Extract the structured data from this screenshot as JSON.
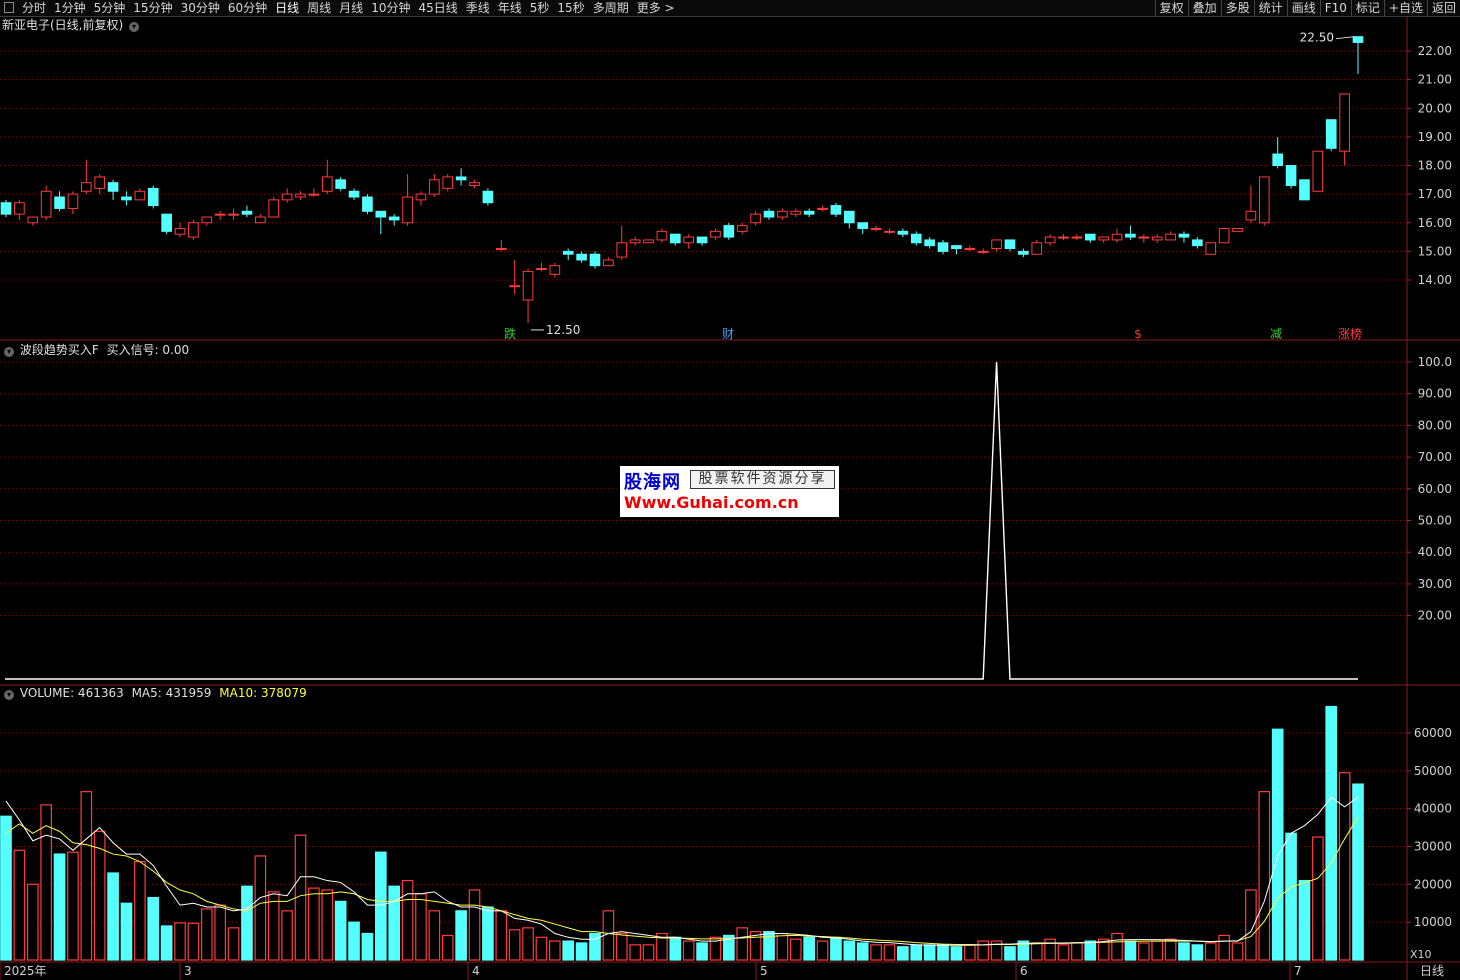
{
  "toolbar": {
    "periods": [
      "分时",
      "1分钟",
      "5分钟",
      "15分钟",
      "30分钟",
      "60分钟",
      "日线",
      "周线",
      "月线",
      "10分钟",
      "45日线",
      "季线",
      "年线",
      "5秒",
      "15秒",
      "多周期",
      "更多 >"
    ],
    "active_period": "日线",
    "right_buttons": [
      "复权",
      "叠加",
      "多股",
      "统计",
      "画线",
      "F10",
      "标记",
      "+自选",
      "返回"
    ]
  },
  "price_panel": {
    "title": "新亚电子(日线,前复权)",
    "axis_ticks": [
      "22.00",
      "21.00",
      "20.00",
      "19.00",
      "18.00",
      "17.00",
      "16.00",
      "15.00",
      "14.00"
    ],
    "high_label": "22.50",
    "low_label": "12.50",
    "markers": [
      {
        "text": "跌",
        "color": "#30d030"
      },
      {
        "text": "财",
        "color": "#40a0ff"
      },
      {
        "text": "$",
        "color": "#ff3030"
      },
      {
        "text": "减",
        "color": "#30d030"
      },
      {
        "text": "涨榜",
        "color": "#ff4040"
      }
    ]
  },
  "indicator_panel": {
    "title": "波段趋势买入F",
    "signal_label": "买入信号: 0.00",
    "axis_ticks": [
      "100.0",
      "90.00",
      "80.00",
      "70.00",
      "60.00",
      "50.00",
      "40.00",
      "30.00",
      "20.00"
    ]
  },
  "volume_panel": {
    "volume_label": "VOLUME: 461363",
    "ma5_label": "MA5: 431959",
    "ma10_label": "MA10: 378079",
    "axis_ticks": [
      "60000",
      "50000",
      "40000",
      "30000",
      "20000",
      "10000"
    ],
    "unit_label": "X10"
  },
  "x_axis": {
    "labels": [
      "2025年",
      "3",
      "4",
      "5",
      "6",
      "7"
    ],
    "period_label": "日线"
  },
  "watermark": {
    "brand": "股海网",
    "slogan": "股票软件资源分享",
    "url": "Www.Guhai.com.cn"
  },
  "colors": {
    "up": "#ff3b3b",
    "down": "#54ffff",
    "ma5": "#ffffff",
    "ma10": "#ffff40",
    "grid": "#8b0000"
  },
  "chart_data": {
    "type": "candlestick",
    "candles": [
      [
        16.7,
        16.3,
        16.8,
        16.2
      ],
      [
        16.3,
        16.7,
        16.8,
        16.1
      ],
      [
        16.0,
        16.2,
        16.2,
        15.9
      ],
      [
        16.2,
        17.1,
        17.3,
        16.1
      ],
      [
        16.9,
        16.5,
        17.1,
        16.4
      ],
      [
        16.5,
        17.0,
        17.1,
        16.3
      ],
      [
        17.1,
        17.4,
        18.2,
        17.0
      ],
      [
        17.2,
        17.6,
        17.7,
        17.0
      ],
      [
        17.4,
        17.1,
        17.5,
        16.8
      ],
      [
        16.9,
        16.8,
        17.1,
        16.6
      ],
      [
        16.8,
        17.1,
        17.2,
        16.8
      ],
      [
        17.2,
        16.6,
        17.3,
        16.5
      ],
      [
        16.3,
        15.7,
        16.3,
        15.6
      ],
      [
        15.6,
        15.8,
        16.0,
        15.5
      ],
      [
        15.5,
        16.0,
        16.1,
        15.4
      ],
      [
        16.0,
        16.2,
        16.2,
        15.9
      ],
      [
        16.3,
        16.3,
        16.4,
        16.1
      ],
      [
        16.3,
        16.3,
        16.5,
        16.1
      ],
      [
        16.4,
        16.3,
        16.6,
        16.2
      ],
      [
        16.0,
        16.2,
        16.3,
        16.0
      ],
      [
        16.2,
        16.8,
        16.9,
        16.2
      ],
      [
        16.8,
        17.0,
        17.2,
        16.7
      ],
      [
        16.9,
        17.0,
        17.1,
        16.8
      ],
      [
        17.0,
        17.0,
        17.2,
        16.9
      ],
      [
        17.1,
        17.6,
        18.2,
        17.0
      ],
      [
        17.5,
        17.2,
        17.6,
        17.1
      ],
      [
        17.1,
        16.9,
        17.2,
        16.8
      ],
      [
        16.9,
        16.4,
        17.0,
        16.3
      ],
      [
        16.4,
        16.2,
        16.4,
        15.6
      ],
      [
        16.2,
        16.1,
        16.3,
        15.9
      ],
      [
        16.0,
        16.9,
        17.7,
        15.9
      ],
      [
        16.8,
        17.0,
        17.1,
        16.6
      ],
      [
        17.0,
        17.5,
        17.7,
        16.9
      ],
      [
        17.2,
        17.6,
        17.7,
        17.1
      ],
      [
        17.6,
        17.5,
        17.9,
        17.3
      ],
      [
        17.3,
        17.4,
        17.5,
        17.2
      ],
      [
        17.1,
        16.7,
        17.2,
        16.6
      ],
      [
        15.1,
        15.1,
        15.4,
        15.0
      ],
      [
        13.8,
        13.8,
        14.7,
        13.5
      ],
      [
        13.3,
        14.3,
        14.4,
        12.5
      ],
      [
        14.4,
        14.4,
        14.6,
        14.3
      ],
      [
        14.2,
        14.5,
        14.6,
        14.1
      ],
      [
        15.0,
        14.9,
        15.1,
        14.7
      ],
      [
        14.9,
        14.7,
        15.0,
        14.6
      ],
      [
        14.9,
        14.5,
        15.0,
        14.4
      ],
      [
        14.5,
        14.7,
        14.8,
        14.5
      ],
      [
        14.8,
        15.3,
        15.9,
        14.7
      ],
      [
        15.3,
        15.4,
        15.5,
        15.2
      ],
      [
        15.3,
        15.4,
        15.4,
        15.3
      ],
      [
        15.4,
        15.7,
        15.8,
        15.3
      ],
      [
        15.6,
        15.3,
        15.6,
        15.2
      ],
      [
        15.3,
        15.5,
        15.6,
        15.1
      ],
      [
        15.5,
        15.3,
        15.5,
        15.2
      ],
      [
        15.5,
        15.7,
        15.8,
        15.4
      ],
      [
        15.9,
        15.5,
        16.0,
        15.4
      ],
      [
        15.7,
        15.9,
        16.0,
        15.6
      ],
      [
        16.0,
        16.3,
        16.4,
        15.9
      ],
      [
        16.4,
        16.2,
        16.5,
        16.1
      ],
      [
        16.2,
        16.4,
        16.5,
        16.1
      ],
      [
        16.3,
        16.4,
        16.5,
        16.2
      ],
      [
        16.4,
        16.3,
        16.5,
        16.2
      ],
      [
        16.5,
        16.5,
        16.6,
        16.4
      ],
      [
        16.6,
        16.3,
        16.7,
        16.2
      ],
      [
        16.4,
        16.0,
        16.4,
        15.8
      ],
      [
        16.0,
        15.8,
        16.0,
        15.6
      ],
      [
        15.8,
        15.8,
        15.9,
        15.7
      ],
      [
        15.7,
        15.7,
        15.8,
        15.6
      ],
      [
        15.7,
        15.6,
        15.8,
        15.5
      ],
      [
        15.6,
        15.3,
        15.7,
        15.2
      ],
      [
        15.4,
        15.2,
        15.5,
        15.1
      ],
      [
        15.3,
        15.0,
        15.4,
        14.9
      ],
      [
        15.2,
        15.1,
        15.2,
        14.9
      ],
      [
        15.1,
        15.1,
        15.2,
        15.0
      ],
      [
        15.0,
        15.0,
        15.1,
        14.9
      ],
      [
        15.1,
        15.4,
        15.4,
        15.0
      ],
      [
        15.4,
        15.1,
        15.4,
        15.0
      ],
      [
        15.0,
        14.9,
        15.1,
        14.8
      ],
      [
        14.9,
        15.3,
        15.4,
        14.9
      ],
      [
        15.3,
        15.5,
        15.6,
        15.2
      ],
      [
        15.5,
        15.5,
        15.6,
        15.4
      ],
      [
        15.5,
        15.5,
        15.6,
        15.4
      ],
      [
        15.6,
        15.4,
        15.6,
        15.3
      ],
      [
        15.4,
        15.5,
        15.5,
        15.3
      ],
      [
        15.4,
        15.6,
        15.8,
        15.3
      ],
      [
        15.6,
        15.5,
        15.9,
        15.4
      ],
      [
        15.5,
        15.5,
        15.6,
        15.3
      ],
      [
        15.4,
        15.5,
        15.6,
        15.3
      ],
      [
        15.4,
        15.6,
        15.7,
        15.4
      ],
      [
        15.6,
        15.5,
        15.7,
        15.3
      ],
      [
        15.4,
        15.2,
        15.5,
        15.1
      ],
      [
        14.9,
        15.3,
        15.3,
        14.9
      ],
      [
        15.3,
        15.8,
        15.8,
        15.3
      ],
      [
        15.7,
        15.8,
        15.8,
        15.7
      ],
      [
        16.1,
        16.4,
        17.3,
        16.0
      ],
      [
        16.0,
        17.6,
        17.6,
        15.9
      ],
      [
        18.4,
        18.0,
        19.0,
        17.9
      ],
      [
        18.0,
        17.3,
        18.0,
        17.2
      ],
      [
        17.5,
        16.8,
        17.5,
        16.8
      ],
      [
        17.1,
        18.5,
        18.5,
        17.1
      ],
      [
        19.6,
        18.6,
        19.6,
        18.5
      ],
      [
        18.5,
        20.5,
        20.5,
        18.0
      ],
      [
        22.5,
        22.3,
        22.5,
        21.2
      ]
    ],
    "volume": [
      38000,
      29000,
      20000,
      41000,
      28000,
      28500,
      44500,
      34000,
      23000,
      15000,
      26000,
      16500,
      9000,
      9800,
      9700,
      13500,
      14500,
      8500,
      19500,
      27500,
      18000,
      13000,
      33000,
      19000,
      18500,
      15500,
      10000,
      7000,
      28500,
      19500,
      21000,
      17500,
      13000,
      6500,
      13000,
      18500,
      14000,
      13000,
      8000,
      8500,
      6000,
      5000,
      5000,
      4500,
      7000,
      13000,
      7000,
      4000,
      4000,
      7000,
      6000,
      5000,
      4500,
      6000,
      6500,
      8500,
      7500,
      7500,
      7000,
      5500,
      6000,
      5000,
      6000,
      5000,
      4500,
      4000,
      4000,
      3500,
      4000,
      4000,
      4000,
      3500,
      4000,
      5000,
      5000,
      3500,
      5000,
      4500,
      5500,
      4000,
      4500,
      5000,
      5500,
      7000,
      5000,
      4500,
      5000,
      5500,
      4500,
      4000,
      4500,
      6500,
      4500,
      18500,
      44500,
      61000,
      33500,
      21000,
      32500,
      67000,
      49500,
      46500
    ],
    "ma5": [
      42000,
      37000,
      31500,
      33000,
      32000,
      29000,
      32000,
      35000,
      31000,
      28000,
      28000,
      25000,
      19500,
      14500,
      15000,
      14000,
      14000,
      13000,
      13500,
      16500,
      17500,
      17000,
      22000,
      22000,
      21000,
      20500,
      18000,
      14500,
      14500,
      15500,
      17500,
      17500,
      18000,
      15500,
      14000,
      14000,
      13000,
      13000,
      11000,
      10500,
      9500,
      7000,
      6000,
      5500,
      5500,
      7000,
      7500,
      7000,
      6500,
      6000,
      6000,
      5500,
      5000,
      5000,
      5500,
      6000,
      6500,
      7000,
      7000,
      6800,
      6500,
      6000,
      5800,
      5500,
      5000,
      4700,
      4600,
      4300,
      4000,
      3900,
      3900,
      3900,
      3900,
      4000,
      4200,
      4200,
      4400,
      4500,
      4500,
      4500,
      4600,
      4600,
      4900,
      5300,
      5400,
      5400,
      5400,
      5300,
      5200,
      5000,
      4800,
      5000,
      5000,
      7500,
      15500,
      27500,
      33500,
      35500,
      38500,
      43000,
      40500,
      43000
    ],
    "ma10": [
      33500,
      36000,
      33500,
      35500,
      34000,
      31000,
      30500,
      29500,
      28000,
      27500,
      26000,
      23500,
      20500,
      18500,
      17500,
      15500,
      14500,
      13500,
      13000,
      15000,
      15500,
      15500,
      17000,
      17500,
      17500,
      18000,
      17500,
      16000,
      15500,
      15500,
      16000,
      16000,
      15500,
      15000,
      14500,
      14500,
      14000,
      13000,
      12000,
      11000,
      10500,
      9500,
      8500,
      7500,
      7500,
      7000,
      6600,
      6300,
      6000,
      5800,
      5800,
      5700,
      5600,
      5600,
      5700,
      5800,
      6000,
      6200,
      6400,
      6500,
      6300,
      6200,
      6000,
      5800,
      5500,
      5300,
      5100,
      4900,
      4600,
      4400,
      4200,
      4100,
      4100,
      4000,
      4100,
      4100,
      4200,
      4300,
      4400,
      4400,
      4500,
      4600,
      4700,
      4800,
      4900,
      5000,
      5000,
      5000,
      5000,
      5000,
      4900,
      5000,
      5100,
      6200,
      10200,
      16300,
      19300,
      20400,
      21600,
      25700,
      32000,
      37800
    ],
    "buy_signal": {
      "peak_index": 74,
      "peak_value": 100,
      "base_value": 0
    },
    "x_labels": [
      "2025年",
      "3",
      "4",
      "5",
      "6",
      "7"
    ],
    "price_range": [
      12.3,
      22.8
    ],
    "volume_range": [
      0,
      68000
    ],
    "signal_range": [
      0,
      100
    ]
  }
}
